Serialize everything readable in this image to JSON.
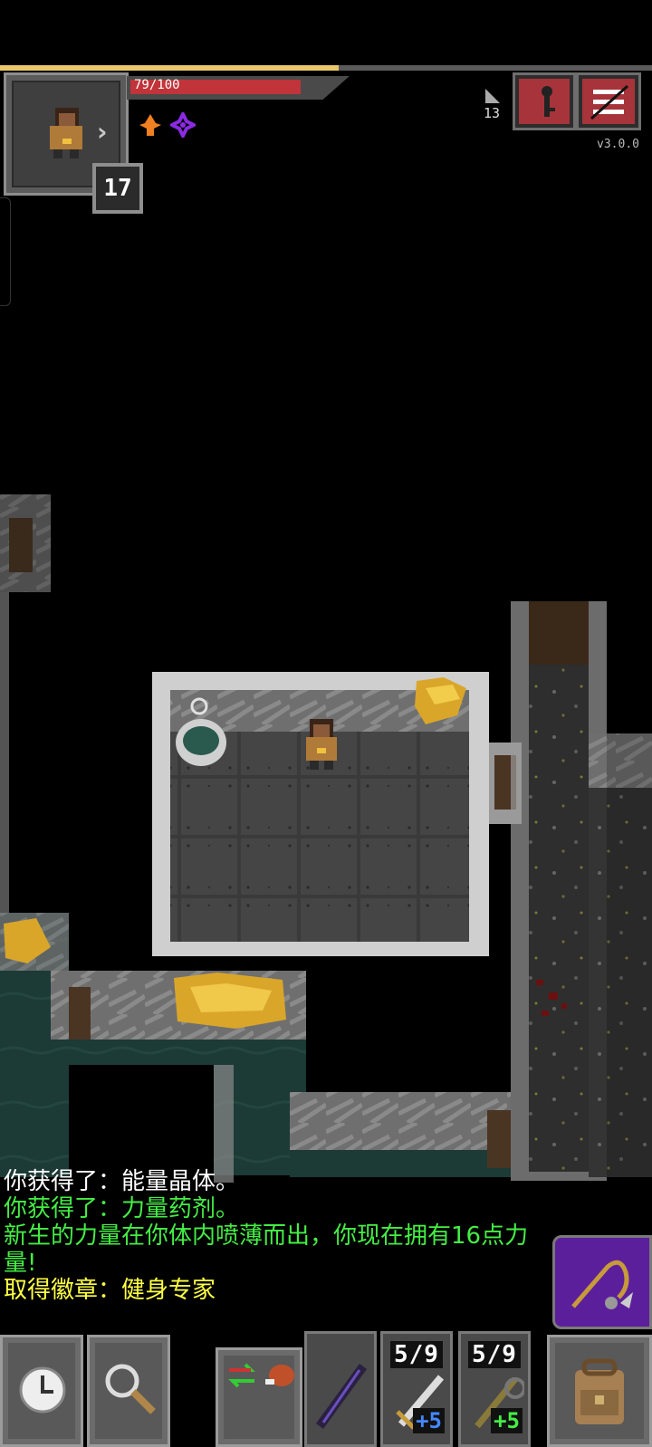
{
  "hud": {
    "hp_text": "79/100",
    "hp_fraction": 0.79,
    "xp_fraction": 0.52,
    "level": "17",
    "depth": "13",
    "version": "v3.0.0",
    "buffs": [
      "fire-buff-icon",
      "mind-vision-buff-icon"
    ],
    "colors": {
      "hp": "#c0343a",
      "xp": "#e8c66a",
      "danger_button": "#a6343a"
    }
  },
  "log": [
    {
      "text": "你获得了：能量晶体。",
      "color": "white"
    },
    {
      "text": "你获得了：力量药剂。",
      "color": "green"
    },
    {
      "text": "新生的力量在你体内喷薄而出，你现在拥有16点力量!",
      "color": "green"
    },
    {
      "text": "取得徽章：健身专家",
      "color": "yellow"
    }
  ],
  "toolbar": {
    "wait": "clock-icon",
    "search": "magnifier-icon",
    "swap": "swap-arrows-icon",
    "meat": "meat-icon",
    "slot1": {
      "icon": "wand-icon"
    },
    "slot2": {
      "icon": "sword-icon",
      "charges": "5/9",
      "bonus": "+5",
      "bonus_color": "#4488ff"
    },
    "slot3": {
      "icon": "chain-weapon-icon",
      "charges": "5/9",
      "bonus": "+5",
      "bonus_color": "#44ee44"
    },
    "backpack": "backpack-icon",
    "attack": "whip-attack-icon"
  }
}
